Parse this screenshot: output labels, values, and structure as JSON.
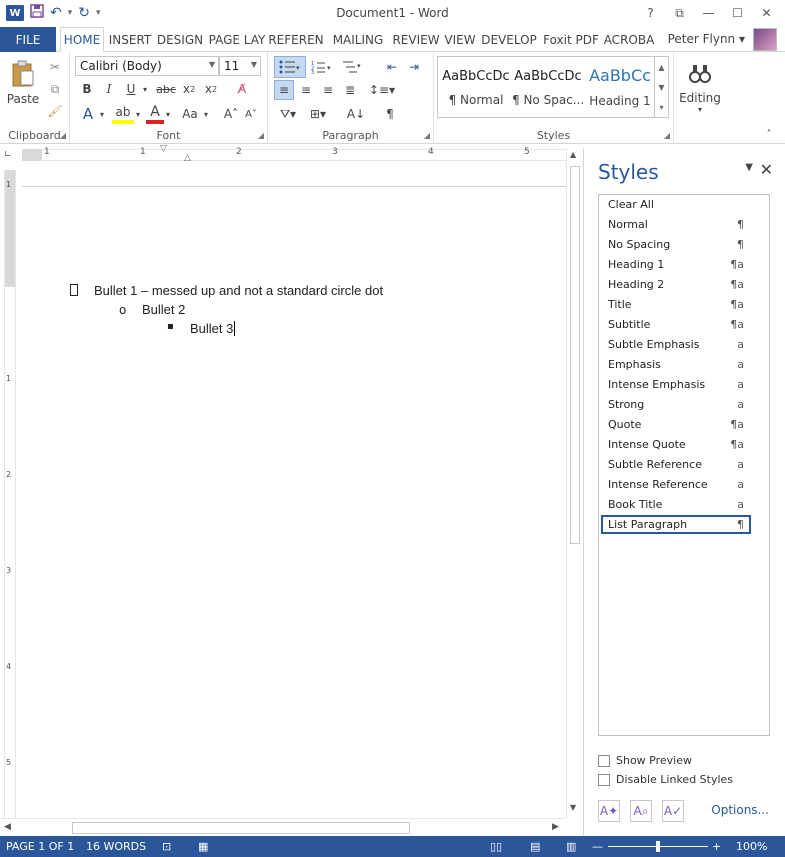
{
  "app": {
    "title": "Document1 - Word",
    "window_controls": [
      "?",
      "⧉",
      "—",
      "☐",
      "✕"
    ]
  },
  "qat": {
    "undo": "↶",
    "redo": "↻",
    "more": "▾"
  },
  "tabs": {
    "file": "FILE",
    "items": [
      "HOME",
      "INSERT",
      "DESIGN",
      "PAGE LAY",
      "REFEREN",
      "MAILING",
      "REVIEW",
      "VIEW",
      "DEVELOP",
      "Foxit PDF",
      "ACROBA"
    ],
    "active": "HOME",
    "user": "Peter Flynn"
  },
  "ribbon": {
    "clipboard": {
      "label": "Clipboard",
      "paste": "Paste"
    },
    "font": {
      "label": "Font",
      "family": "Calibri (Body)",
      "size": "11"
    },
    "paragraph": {
      "label": "Paragraph"
    },
    "styles": {
      "label": "Styles",
      "gallery": [
        {
          "sample": "AaBbCcDc",
          "name": "¶ Normal"
        },
        {
          "sample": "AaBbCcDc",
          "name": "¶ No Spac..."
        },
        {
          "sample": "AaBbCc",
          "name": "Heading 1"
        }
      ]
    },
    "editing": {
      "label": "Editing"
    }
  },
  "ruler": {
    "numbers": [
      "1",
      "1",
      "2",
      "3",
      "4",
      "5"
    ]
  },
  "vruler": {
    "numbers": [
      "1",
      "1",
      "2",
      "3",
      "4",
      "5"
    ]
  },
  "document": {
    "lines": [
      {
        "bullet": "",
        "text": "Bullet 1 – messed up and not a standard circle dot"
      },
      {
        "bullet": "o",
        "text": "Bullet 2"
      },
      {
        "bullet": "▪",
        "text": "Bullet 3"
      }
    ]
  },
  "styles_pane": {
    "title": "Styles",
    "items": [
      {
        "name": "Clear All",
        "sym": ""
      },
      {
        "name": "Normal",
        "sym": "¶"
      },
      {
        "name": "No Spacing",
        "sym": "¶"
      },
      {
        "name": "Heading 1",
        "sym": "¶a"
      },
      {
        "name": "Heading 2",
        "sym": "¶a"
      },
      {
        "name": "Title",
        "sym": "¶a"
      },
      {
        "name": "Subtitle",
        "sym": "¶a"
      },
      {
        "name": "Subtle Emphasis",
        "sym": "a"
      },
      {
        "name": "Emphasis",
        "sym": "a"
      },
      {
        "name": "Intense Emphasis",
        "sym": "a"
      },
      {
        "name": "Strong",
        "sym": "a"
      },
      {
        "name": "Quote",
        "sym": "¶a"
      },
      {
        "name": "Intense Quote",
        "sym": "¶a"
      },
      {
        "name": "Subtle Reference",
        "sym": "a"
      },
      {
        "name": "Intense Reference",
        "sym": "a"
      },
      {
        "name": "Book Title",
        "sym": "a"
      },
      {
        "name": "List Paragraph",
        "sym": "¶"
      }
    ],
    "selected": "List Paragraph",
    "show_preview": "Show Preview",
    "disable_linked": "Disable Linked Styles",
    "options": "Options..."
  },
  "status": {
    "page": "PAGE 1 OF 1",
    "words": "16 WORDS",
    "zoom": "100%",
    "zoom_level": 100
  },
  "colors": {
    "accent": "#2b579a",
    "heading": "#2e74b5"
  }
}
